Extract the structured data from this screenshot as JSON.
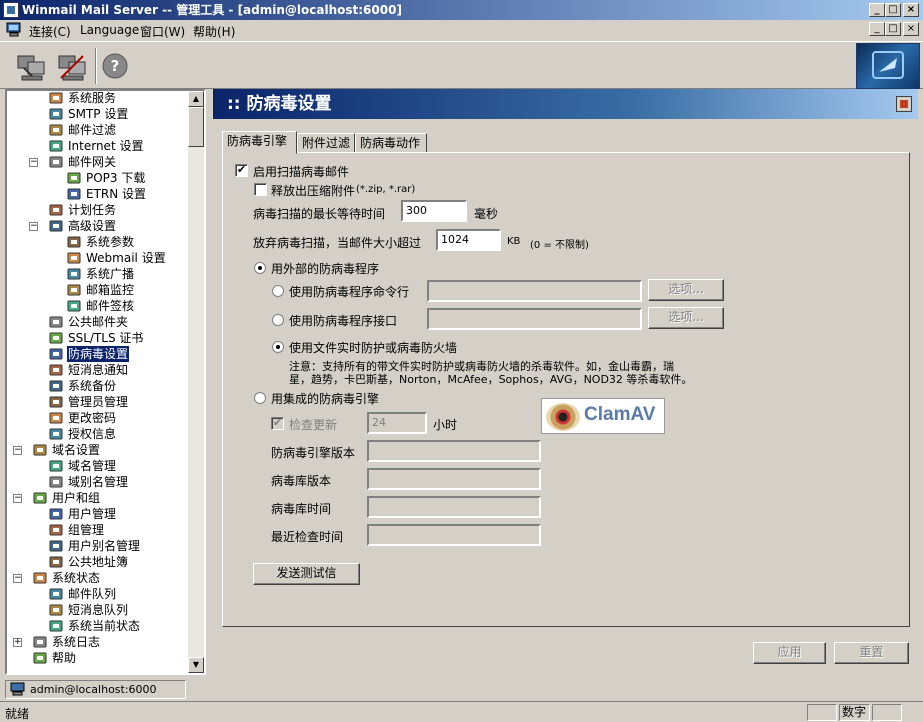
{
  "window": {
    "title": "Winmail Mail Server -- 管理工具 - [admin@localhost:6000]",
    "min": "_",
    "max": "□",
    "close": "×"
  },
  "menu": {
    "items": [
      "连接(C)",
      "Language",
      "窗口(W)",
      "帮助(H)"
    ]
  },
  "tree": {
    "items": [
      {
        "label": "系统服务"
      },
      {
        "label": "SMTP 设置"
      },
      {
        "label": "邮件过滤"
      },
      {
        "label": "Internet 设置"
      },
      {
        "label": "邮件网关"
      },
      {
        "label": "POP3 下载"
      },
      {
        "label": "ETRN 设置"
      },
      {
        "label": "计划任务"
      },
      {
        "label": "高级设置"
      },
      {
        "label": "系统参数"
      },
      {
        "label": "Webmail 设置"
      },
      {
        "label": "系统广播"
      },
      {
        "label": "邮箱监控"
      },
      {
        "label": "邮件签核"
      },
      {
        "label": "公共邮件夹"
      },
      {
        "label": "SSL/TLS 证书"
      },
      {
        "label": "防病毒设置"
      },
      {
        "label": "短消息通知"
      },
      {
        "label": "系统备份"
      },
      {
        "label": "管理员管理"
      },
      {
        "label": "更改密码"
      },
      {
        "label": "授权信息"
      },
      {
        "label": "域名设置"
      },
      {
        "label": "域名管理"
      },
      {
        "label": "域别名管理"
      },
      {
        "label": "用户和组"
      },
      {
        "label": "用户管理"
      },
      {
        "label": "组管理"
      },
      {
        "label": "用户别名管理"
      },
      {
        "label": "公共地址簿"
      },
      {
        "label": "系统状态"
      },
      {
        "label": "邮件队列"
      },
      {
        "label": "短消息队列"
      },
      {
        "label": "系统当前状态"
      },
      {
        "label": "系统日志"
      },
      {
        "label": "帮助"
      }
    ],
    "selected": "防病毒设置"
  },
  "main": {
    "title": ":: 防病毒设置",
    "tabs": [
      "防病毒引擎",
      "附件过滤",
      "防病毒动作"
    ],
    "enable_scan": {
      "label": "启用扫描病毒邮件",
      "checked": true
    },
    "release_zip": {
      "label": "释放出压缩附件",
      "ext": "(*.zip, *.rar)",
      "checked": false
    },
    "max_wait": {
      "label": "病毒扫描的最长等待时间",
      "value": "300",
      "unit": "毫秒"
    },
    "skip_size": {
      "label": "放弃病毒扫描，当邮件大小超过",
      "value": "1024",
      "unit": "KB",
      "note": "(0 = 不限制)"
    },
    "external": {
      "label": "用外部的防病毒程序",
      "cmd": {
        "label": "使用防病毒程序命令行",
        "value": "",
        "button": "选项..."
      },
      "api": {
        "label": "使用防病毒程序接口",
        "value": "",
        "button": "选项..."
      },
      "realtime": {
        "label": "使用文件实时防护或病毒防火墙",
        "note1": "注意：支持所有的带文件实时防护或病毒防火墙的杀毒软件。如，金山毒霸，瑞",
        "note2": "星，趋势，卡巴斯基，Norton，McAfee，Sophos，AVG，NOD32 等杀毒软件。"
      }
    },
    "builtin": {
      "label": "用集成的防病毒引擎",
      "check_update": {
        "label": "检查更新",
        "value": "24",
        "unit": "小时"
      },
      "engine_version": "防病毒引擎版本",
      "db_version": "病毒库版本",
      "db_time": "病毒库时间",
      "last_check": "最近检查时间",
      "logo": "ClamAV"
    },
    "send_test": "发送测试信",
    "apply": "应用",
    "reset": "重置"
  },
  "status": {
    "user": "admin@localhost:6000",
    "ready": "就绪",
    "num": "数字"
  },
  "colors": {
    "title_start": "#0a246a",
    "title_end": "#a6caf0",
    "face": "#d4d0c8",
    "selection": "#0a246a"
  }
}
